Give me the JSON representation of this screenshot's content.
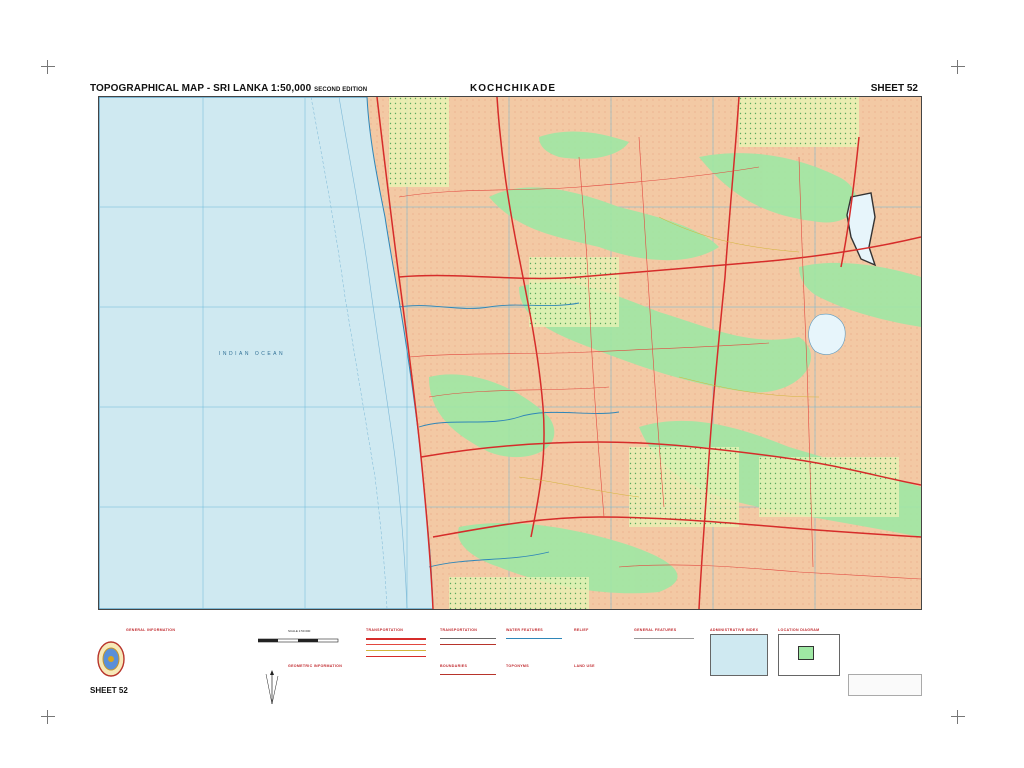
{
  "header": {
    "title": "TOPOGRAPHICAL MAP - SRI LANKA 1:50,000",
    "edition": "SECOND EDITION",
    "sheet_name": "KOCHCHIKADE",
    "sheet_number": "SHEET 52"
  },
  "map": {
    "ocean_label": "INDIAN OCEAN",
    "colors": {
      "ocean": "#cfe9f1",
      "land": "#f3c9a4",
      "vegetation": "#9fe8a4",
      "scrub": "#e9f3b4",
      "road_main": "#d62c2a",
      "grid": "#6ab8d8"
    }
  },
  "legend": {
    "sections": [
      "GENERAL INFORMATION",
      "TRANSPORTATION",
      "TRANSPORTATION",
      "WATER FEATURES",
      "RELIEF",
      "GENERAL FEATURES",
      "ADMINISTRATIVE INDEX",
      "LOCATION DIAGRAM"
    ],
    "geometric_title": "GEOMETRIC INFORMATION",
    "boundaries_title": "BOUNDARIES",
    "land_use_title": "LAND USE",
    "toponym_title": "TOPONYMS",
    "scale_title": "SCALE 1:50 000",
    "footer_sheet": "SHEET 52"
  }
}
